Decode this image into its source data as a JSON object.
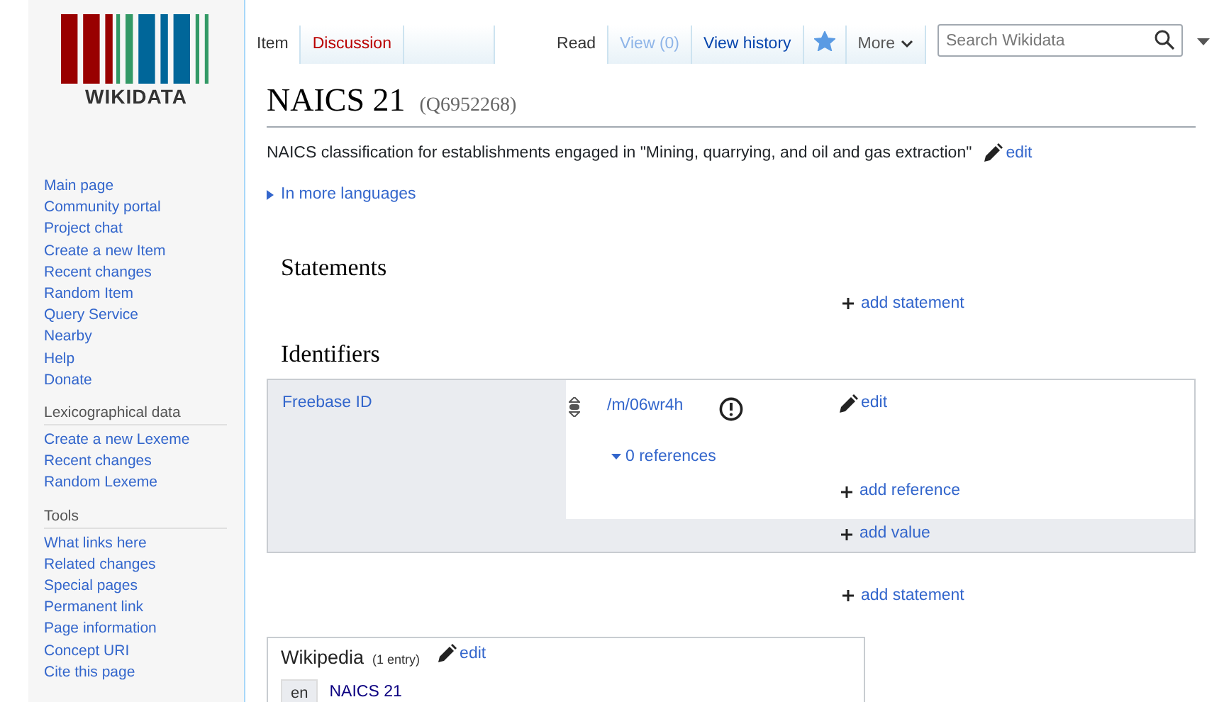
{
  "logo": {
    "wordmark": "WIKIDATA"
  },
  "sidebar": {
    "sections": [
      {
        "items": [
          "Main page",
          "Community portal",
          "Project chat",
          "Create a new Item",
          "Recent changes",
          "Random Item",
          "Query Service",
          "Nearby",
          "Help",
          "Donate"
        ]
      },
      {
        "heading": "Lexicographical data",
        "items": [
          "Create a new Lexeme",
          "Recent changes",
          "Random Lexeme"
        ]
      },
      {
        "heading": "Tools",
        "items": [
          "What links here",
          "Related changes",
          "Special pages",
          "Permanent link",
          "Page information",
          "Concept URI",
          "Cite this page"
        ]
      }
    ]
  },
  "left_tabs": [
    {
      "label": "Item",
      "selected": true,
      "missing": false
    },
    {
      "label": "Discussion",
      "selected": false,
      "missing": true
    }
  ],
  "right_tabs": [
    {
      "label": "Read",
      "selected": true,
      "disabled": false
    },
    {
      "label": "View (0)",
      "selected": false,
      "disabled": true
    },
    {
      "label": "View history",
      "selected": false,
      "disabled": false
    }
  ],
  "watch": {
    "watched": true
  },
  "more_menu": {
    "label": "More"
  },
  "search": {
    "placeholder": "Search Wikidata"
  },
  "title": {
    "label": "NAICS 21",
    "id": "(Q6952268)"
  },
  "description": {
    "text": "NAICS classification for establishments engaged in \"Mining, quarrying, and oil and gas extraction\"",
    "edit": "edit"
  },
  "more_languages": "In more languages",
  "statements": {
    "heading": "Statements",
    "add": "add statement"
  },
  "identifiers": {
    "heading": "Identifiers",
    "groups": [
      {
        "property": "Freebase ID",
        "values": [
          {
            "value": "/m/06wr4h",
            "edit": "edit",
            "references": "0 references",
            "add_reference": "add reference"
          }
        ],
        "add_value": "add value"
      }
    ],
    "add": "add statement"
  },
  "sitelinks": {
    "heading": "Wikipedia",
    "count": "(1 entry)",
    "edit": "edit",
    "links": [
      {
        "lang": "en",
        "title": "NAICS 21"
      }
    ]
  }
}
